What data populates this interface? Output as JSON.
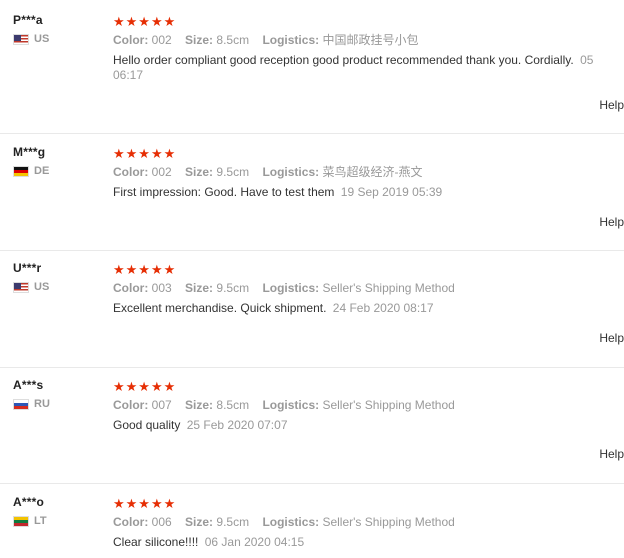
{
  "labels": {
    "color": "Color:",
    "size": "Size:",
    "logistics": "Logistics:",
    "help": "Help"
  },
  "reviews": [
    {
      "user": "P***a",
      "country": "US",
      "stars": "★★★★★",
      "color": "002",
      "size": "8.5cm",
      "logistics": "中国邮政挂号小包",
      "text": "Hello order compliant good reception good product recommended thank you. Cordially.",
      "date": "05",
      "date_cont": "06:17"
    },
    {
      "user": "M***g",
      "country": "DE",
      "stars": "★★★★★",
      "color": "002",
      "size": "9.5cm",
      "logistics": "菜鸟超级经济-燕文",
      "text": "First impression: Good. Have to test them",
      "date": "19 Sep 2019 05:39"
    },
    {
      "user": "U***r",
      "country": "US",
      "stars": "★★★★★",
      "color": "003",
      "size": "9.5cm",
      "logistics": "Seller's Shipping Method",
      "text": "Excellent merchandise. Quick shipment.",
      "date": "24 Feb 2020 08:17"
    },
    {
      "user": "A***s",
      "country": "RU",
      "stars": "★★★★★",
      "color": "007",
      "size": "8.5cm",
      "logistics": "Seller's Shipping Method",
      "text": "Good quality",
      "date": "25 Feb 2020 07:07"
    },
    {
      "user": "A***o",
      "country": "LT",
      "stars": "★★★★★",
      "color": "006",
      "size": "9.5cm",
      "logistics": "Seller's Shipping Method",
      "text": "Clear silicone!!!!",
      "date": "06 Jan 2020 04:15"
    }
  ]
}
